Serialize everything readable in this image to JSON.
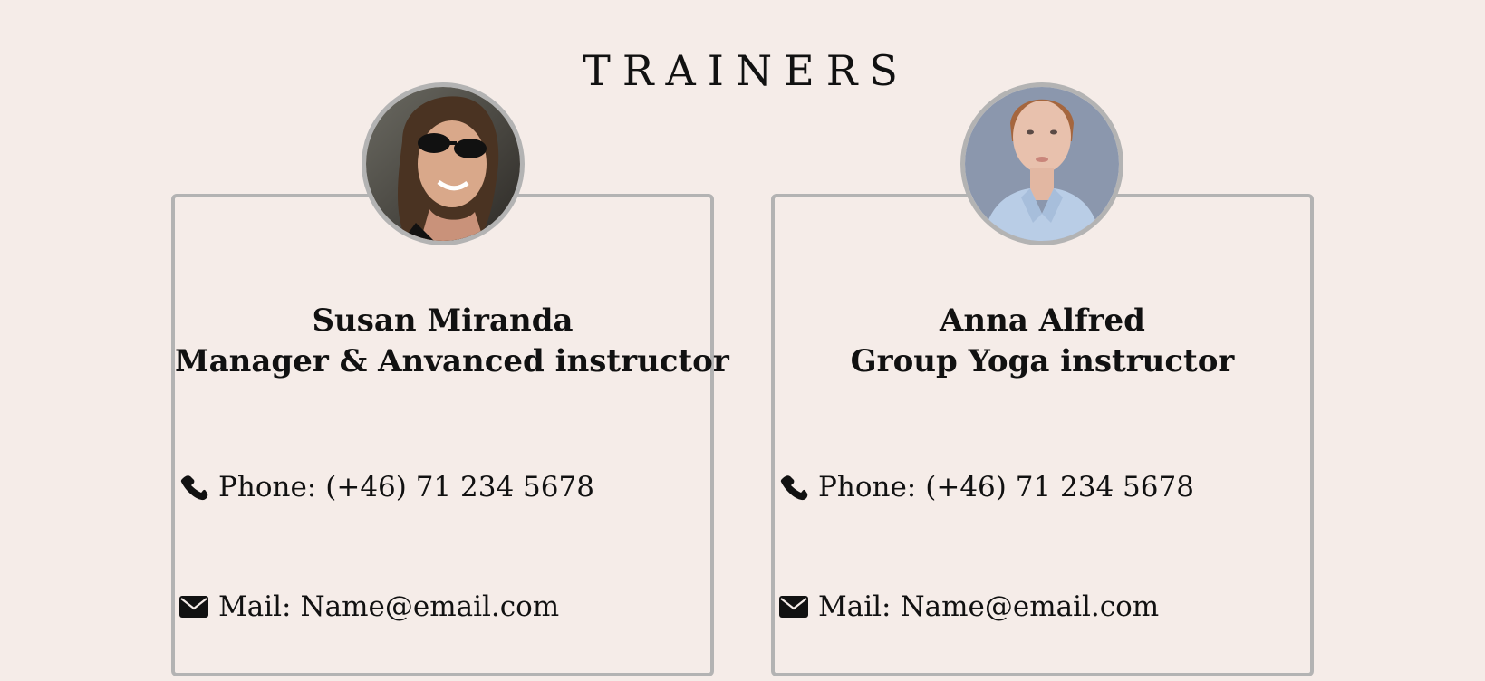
{
  "section": {
    "title": "TRAINERS"
  },
  "trainers": [
    {
      "name": "Susan Miranda",
      "role": "Manager & Anvanced instructor",
      "phone_label": "Phone:",
      "phone_value": "(+46) 71 234 5678",
      "mail_label": "Mail:",
      "mail_value": "Name@email.com",
      "photo_icon": "trainer-photo-susan"
    },
    {
      "name": "Anna Alfred",
      "role": "Group Yoga instructor",
      "phone_label": "Phone:",
      "phone_value": "(+46) 71 234 5678",
      "mail_label": "Mail:",
      "mail_value": "Name@email.com",
      "photo_icon": "trainer-photo-anna"
    }
  ],
  "icons": {
    "phone": "phone-icon",
    "mail": "envelope-icon"
  },
  "colors": {
    "background": "#f5ece8",
    "border": "#b3b3b3",
    "text": "#111111"
  }
}
